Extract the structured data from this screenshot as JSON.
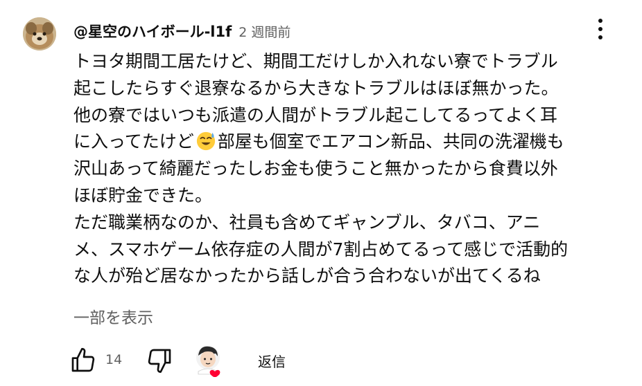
{
  "comment": {
    "author": "@星空のハイボール-l1f",
    "time": "2 週間前",
    "lines_before_emoji": [
      "トヨタ期間工居たけど、期間工だけしか入れない寮でトラブル",
      "起こしたらすぐ退寮なるから大きなトラブルはほぼ無かった。",
      "他の寮ではいつも派遣の人間がトラブル起こしてるってよく耳"
    ],
    "emoji_line_prefix": "に入ってたけど",
    "emoji_icon": "sweat-smile-emoji",
    "emoji_line_suffix": "部屋も個室でエアコン新品、共同の洗濯機も",
    "lines_after_emoji": [
      "沢山あって綺麗だったしお金も使うこと無かったから食費以外",
      "ほぼ貯金できた。",
      "ただ職業柄なのか、社員も含めてギャンブル、タバコ、アニ",
      "メ、スマホゲーム依存症の人間が7割占めてるって感じで活動的",
      "な人が殆ど居なかったから話しが合う合わないが出てくるね"
    ],
    "show_more_label": "一部を表示",
    "like_count": "14",
    "reply_label": "返信"
  },
  "icons": {
    "avatar": "dog-avatar",
    "menu": "kebab-menu-icon",
    "like": "thumbs-up-icon",
    "dislike": "thumbs-down-icon",
    "creator_heart": "creator-heart-badge"
  },
  "colors": {
    "text": "#0f0f0f",
    "secondary": "#606060",
    "heart": "#ff0033"
  }
}
